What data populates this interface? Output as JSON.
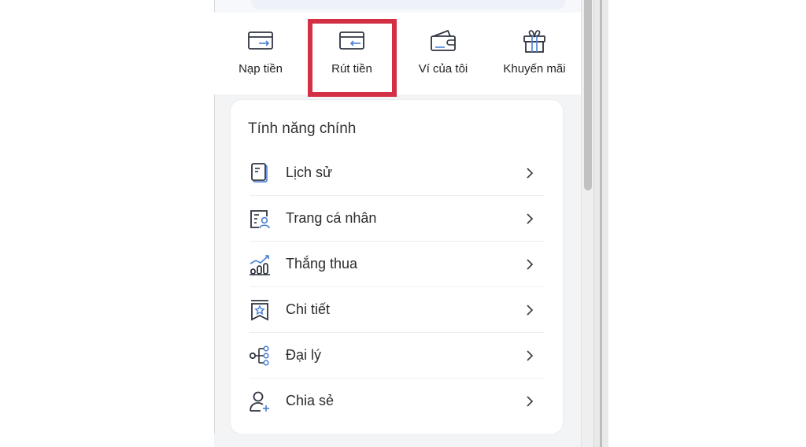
{
  "quick_actions": [
    {
      "label": "Nạp tiền",
      "icon": "deposit-card-icon"
    },
    {
      "label": "Rút tiền",
      "icon": "withdraw-card-icon"
    },
    {
      "label": "Ví của tôi",
      "icon": "wallet-icon"
    },
    {
      "label": "Khuyến mãi",
      "icon": "gift-icon"
    }
  ],
  "highlight": {
    "target": "Rút tiền",
    "color": "#d32f45"
  },
  "main_features": {
    "title": "Tính năng chính",
    "items": [
      {
        "label": "Lịch sử",
        "icon": "history-document-icon"
      },
      {
        "label": "Trang cá nhân",
        "icon": "profile-card-icon"
      },
      {
        "label": "Thắng thua",
        "icon": "win-loss-chart-icon"
      },
      {
        "label": "Chi tiết",
        "icon": "details-star-icon"
      },
      {
        "label": "Đại lý",
        "icon": "agent-tree-icon"
      },
      {
        "label": "Chia sẻ",
        "icon": "share-user-icon"
      }
    ]
  },
  "colors": {
    "accent_blue": "#4a7fd4",
    "icon_dark": "#2f3440",
    "highlight_red": "#d32f45"
  }
}
